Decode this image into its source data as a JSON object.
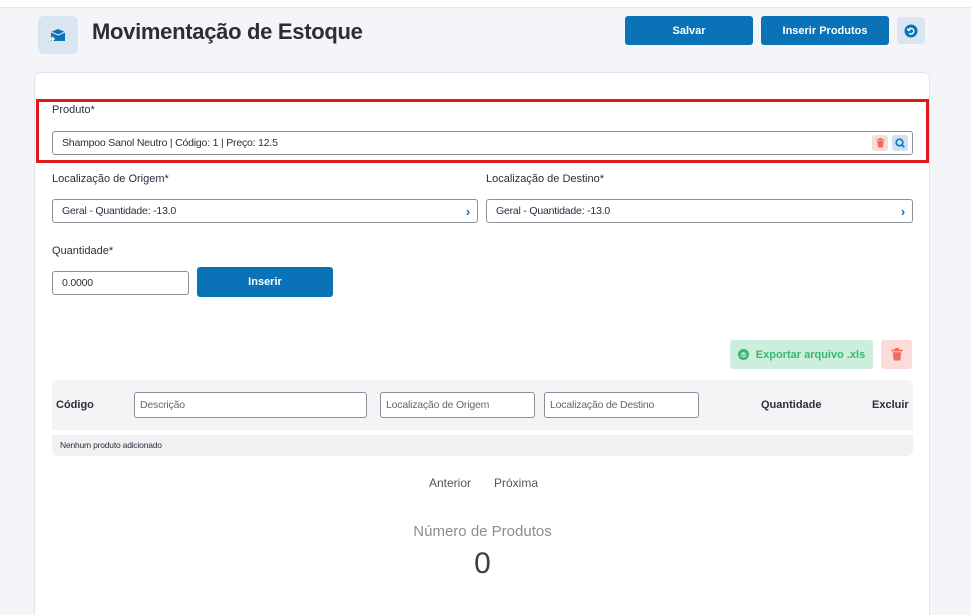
{
  "header": {
    "title": "Movimentação de Estoque",
    "save_label": "Salvar",
    "insert_products_label": "Inserir Produtos"
  },
  "form": {
    "product_label": "Produto*",
    "product_value": "Shampoo Sanol Neutro | Código: 1 | Preço: 12.5",
    "origin_label": "Localização de Origem*",
    "origin_value": "Geral - Quantidade: -13.0",
    "destination_label": "Localização de Destino*",
    "destination_value": "Geral - Quantidade: -13.0",
    "quantity_label": "Quantidade*",
    "quantity_value": "0.0000",
    "insert_label": "Inserir"
  },
  "actions": {
    "export_label": "Exportar arquivo .xls"
  },
  "table": {
    "col_code": "Código",
    "filter_description": "Descrição",
    "filter_origin": "Localização de Origem",
    "filter_destination": "Localização de Destino",
    "col_quantity": "Quantidade",
    "col_delete": "Excluir",
    "empty_message": "Nenhum produto adicionado"
  },
  "pagination": {
    "previous": "Anterior",
    "next": "Próxima"
  },
  "summary": {
    "label": "Número de Produtos",
    "value": "0"
  },
  "colors": {
    "primary": "#0a73b8",
    "highlight": "#e0171b",
    "export_bg": "#cdeedd",
    "export_fg": "#35b96f",
    "trash_bg": "#fbdcda",
    "trash_fg": "#f26b5b"
  }
}
